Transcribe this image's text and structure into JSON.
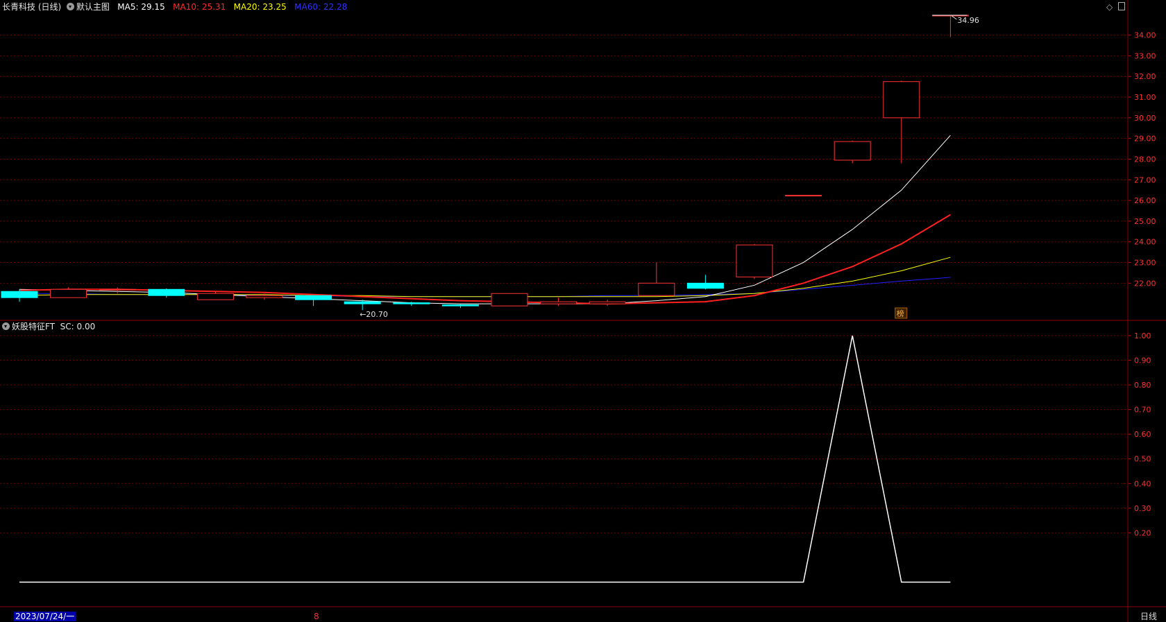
{
  "main": {
    "title": "长青科技 (日线)",
    "template": "默认主图",
    "ma": [
      {
        "label": "MA5: 29.15",
        "color": "#ffffff"
      },
      {
        "label": "MA10: 25.31",
        "color": "#ff2a2a"
      },
      {
        "label": "MA20: 23.25",
        "color": "#ffff00"
      },
      {
        "label": "MA60: 22.28",
        "color": "#3030ff"
      }
    ],
    "high_marker": "34.96",
    "low_marker": "←20.70",
    "lhb_badge": "榜",
    "price_ticks": [
      "34.00",
      "33.00",
      "32.00",
      "31.00",
      "30.00",
      "29.00",
      "28.00",
      "27.00",
      "26.00",
      "25.00",
      "24.00",
      "23.00",
      "22.00"
    ],
    "price_tick_values": [
      34,
      33,
      32,
      31,
      30,
      29,
      28,
      27,
      26,
      25,
      24,
      23,
      22
    ],
    "y_min": 20.2,
    "y_max": 34.96
  },
  "indicator": {
    "title": "妖股特征FT",
    "sc_label": "SC: 0.00",
    "ticks": [
      "1.00",
      "0.90",
      "0.80",
      "0.70",
      "0.60",
      "0.50",
      "0.40",
      "0.30",
      "0.20"
    ],
    "tick_values": [
      1,
      0.9,
      0.8,
      0.7,
      0.6,
      0.5,
      0.4,
      0.3,
      0.2
    ],
    "y_min": -0.1,
    "y_max": 1.0,
    "sc": [
      0,
      0,
      0,
      0,
      0,
      0,
      0,
      0,
      0,
      0,
      0,
      0,
      0,
      0,
      0,
      0,
      0,
      1,
      0,
      0
    ]
  },
  "footer": {
    "date": "2023/07/24/一",
    "marker": "8",
    "period": "日线"
  },
  "chart_data": {
    "type": "candlestick",
    "colors": {
      "up": "#ff3232",
      "down": "#00ffff",
      "ma5": "#ffffff",
      "ma10": "#ff2020",
      "ma20": "#ffff00",
      "ma60": "#2020ff"
    },
    "candles": [
      {
        "o": 21.6,
        "h": 21.7,
        "l": 21.1,
        "c": 21.3
      },
      {
        "o": 21.3,
        "h": 21.8,
        "l": 21.3,
        "c": 21.7
      },
      {
        "o": 21.7,
        "h": 21.8,
        "l": 21.5,
        "c": 21.7
      },
      {
        "o": 21.7,
        "h": 21.75,
        "l": 21.3,
        "c": 21.4
      },
      {
        "o": 21.2,
        "h": 21.6,
        "l": 21.2,
        "c": 21.5
      },
      {
        "o": 21.3,
        "h": 21.5,
        "l": 21.2,
        "c": 21.4
      },
      {
        "o": 21.4,
        "h": 21.4,
        "l": 20.9,
        "c": 21.2
      },
      {
        "o": 21.1,
        "h": 21.2,
        "l": 20.7,
        "c": 21.0
      },
      {
        "o": 21.05,
        "h": 21.1,
        "l": 20.9,
        "c": 21.0
      },
      {
        "o": 20.95,
        "h": 21.0,
        "l": 20.8,
        "c": 20.9
      },
      {
        "o": 20.9,
        "h": 21.5,
        "l": 20.9,
        "c": 21.5
      },
      {
        "o": 21.0,
        "h": 21.3,
        "l": 20.9,
        "c": 21.1
      },
      {
        "o": 21.0,
        "h": 21.2,
        "l": 20.9,
        "c": 21.1
      },
      {
        "o": 21.4,
        "h": 23.0,
        "l": 21.4,
        "c": 22.0
      },
      {
        "o": 22.0,
        "h": 22.4,
        "l": 21.7,
        "c": 21.75
      },
      {
        "o": 22.3,
        "h": 23.9,
        "l": 22.2,
        "c": 23.85
      },
      {
        "o": 26.25,
        "h": 26.25,
        "l": 26.25,
        "c": 26.25
      },
      {
        "o": 27.95,
        "h": 28.9,
        "l": 27.8,
        "c": 28.85
      },
      {
        "o": 30.0,
        "h": 31.8,
        "l": 27.8,
        "c": 31.75
      },
      {
        "o": 34.96,
        "h": 34.96,
        "l": 33.9,
        "c": 34.96
      }
    ],
    "ma5": [
      21.7,
      21.65,
      21.6,
      21.55,
      21.45,
      21.35,
      21.25,
      21.15,
      21.05,
      21.0,
      21.0,
      21.0,
      21.0,
      21.15,
      21.35,
      21.9,
      23.0,
      24.6,
      26.5,
      29.15
    ],
    "ma10": [
      21.65,
      21.7,
      21.7,
      21.65,
      21.6,
      21.55,
      21.45,
      21.35,
      21.25,
      21.15,
      21.1,
      21.05,
      21.0,
      21.05,
      21.1,
      21.4,
      22.0,
      22.8,
      23.9,
      25.31
    ],
    "ma20": [
      21.4,
      21.45,
      21.45,
      21.45,
      21.45,
      21.45,
      21.4,
      21.4,
      21.35,
      21.35,
      21.35,
      21.35,
      21.35,
      21.35,
      21.4,
      21.5,
      21.75,
      22.1,
      22.6,
      23.25
    ],
    "ma60": [
      21.5,
      21.5,
      21.45,
      21.45,
      21.45,
      21.4,
      21.4,
      21.35,
      21.35,
      21.35,
      21.35,
      21.35,
      21.4,
      21.4,
      21.45,
      21.5,
      21.7,
      21.9,
      22.1,
      22.28
    ]
  }
}
